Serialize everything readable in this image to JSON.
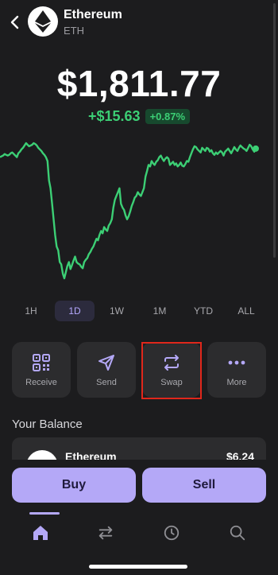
{
  "header": {
    "name": "Ethereum",
    "symbol": "ETH"
  },
  "price": "$1,811.77",
  "change": {
    "absolute": "+$15.63",
    "percent": "+0.87%"
  },
  "colors": {
    "accent": "#b4a8f7",
    "positive": "#3ccf75",
    "highlight": "#e0271b"
  },
  "chart_data": {
    "type": "line",
    "color": "#3ccf75",
    "values": [
      40,
      41,
      42,
      44,
      43,
      42,
      43,
      45,
      46,
      44,
      42,
      40,
      45,
      47,
      50,
      52,
      55,
      58,
      56,
      54,
      55,
      56,
      58,
      57,
      55,
      52,
      50,
      48,
      45,
      43,
      40,
      35,
      10,
      0,
      -20,
      -40,
      -60,
      -75,
      -80,
      -95,
      -98,
      -110,
      -116,
      -108,
      -100,
      -95,
      -104,
      -99,
      -93,
      -88,
      -95,
      -97,
      -98,
      -101,
      -103,
      -95,
      -92,
      -90,
      -85,
      -82,
      -78,
      -75,
      -70,
      -65,
      -67,
      -60,
      -55,
      -58,
      -50,
      -53,
      -55,
      -48,
      -45,
      -40,
      -25,
      -15,
      -10,
      -5,
      0,
      -20,
      -25,
      -28,
      -35,
      -40,
      -36,
      -30,
      -23,
      -18,
      -12,
      -10,
      -5,
      -8,
      -10,
      -5,
      0,
      15,
      22,
      30,
      28,
      35,
      32,
      30,
      34,
      36,
      40,
      42,
      38,
      35,
      38,
      40,
      38,
      30,
      32,
      34,
      30,
      32,
      28,
      30,
      33,
      29,
      28,
      31,
      35,
      34,
      40,
      45,
      50,
      54,
      53,
      50,
      48,
      46,
      52,
      50,
      48,
      52,
      51,
      47,
      49,
      45,
      43,
      46,
      44,
      46,
      48,
      46,
      42,
      47,
      49,
      51,
      48,
      45,
      49,
      53,
      50,
      48,
      52,
      55,
      53,
      51,
      50,
      48,
      52,
      56,
      54,
      50,
      47,
      51
    ]
  },
  "range_tabs": [
    {
      "label": "1H",
      "active": false
    },
    {
      "label": "1D",
      "active": true
    },
    {
      "label": "1W",
      "active": false
    },
    {
      "label": "1M",
      "active": false
    },
    {
      "label": "YTD",
      "active": false
    },
    {
      "label": "ALL",
      "active": false
    }
  ],
  "actions": [
    {
      "label": "Receive",
      "icon": "qr-code-icon"
    },
    {
      "label": "Send",
      "icon": "send-icon"
    },
    {
      "label": "Swap",
      "icon": "swap-arrows-icon"
    },
    {
      "label": "More",
      "icon": "more-dots-icon"
    }
  ],
  "balance": {
    "title": "Your Balance",
    "asset_name": "Ethereum",
    "asset_value": "$6.24"
  },
  "buttons": {
    "buy": "Buy",
    "sell": "Sell"
  },
  "nav": [
    {
      "name": "nav-home",
      "icon": "home-icon",
      "active": true
    },
    {
      "name": "nav-swap",
      "icon": "swap-arrows-icon",
      "active": false
    },
    {
      "name": "nav-activity",
      "icon": "clock-icon",
      "active": false
    },
    {
      "name": "nav-search",
      "icon": "search-icon",
      "active": false
    }
  ]
}
